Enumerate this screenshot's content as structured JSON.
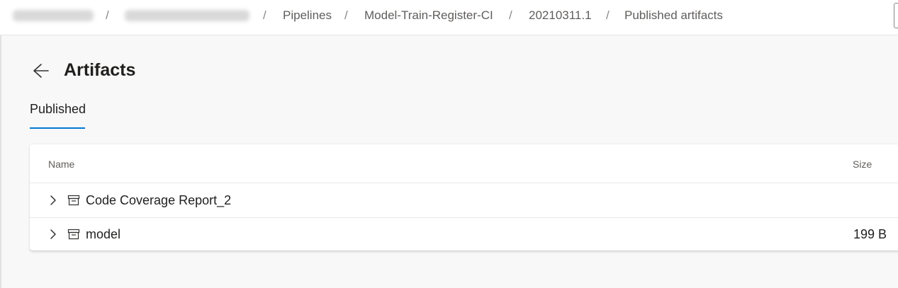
{
  "breadcrumb": {
    "items": [
      {
        "label": "Pipelines"
      },
      {
        "label": "Model-Train-Register-CI"
      },
      {
        "label": "20210311.1"
      },
      {
        "label": "Published artifacts"
      }
    ],
    "separator": "/"
  },
  "page": {
    "title": "Artifacts",
    "back_icon": "arrow-left-icon"
  },
  "tabs": [
    {
      "label": "Published",
      "selected": true
    }
  ],
  "table": {
    "columns": {
      "name": "Name",
      "size": "Size"
    },
    "rows": [
      {
        "name": "Code Coverage Report_2",
        "size": "",
        "expand_icon": "chevron-right-icon",
        "icon": "artifact-icon"
      },
      {
        "name": "model",
        "size": "199 B",
        "expand_icon": "chevron-right-icon",
        "icon": "artifact-icon"
      }
    ]
  },
  "colors": {
    "accent": "#0078d4",
    "background": "#f8f8f8",
    "card": "#ffffff",
    "text": "#201f1e",
    "muted_text": "#605e5c"
  }
}
